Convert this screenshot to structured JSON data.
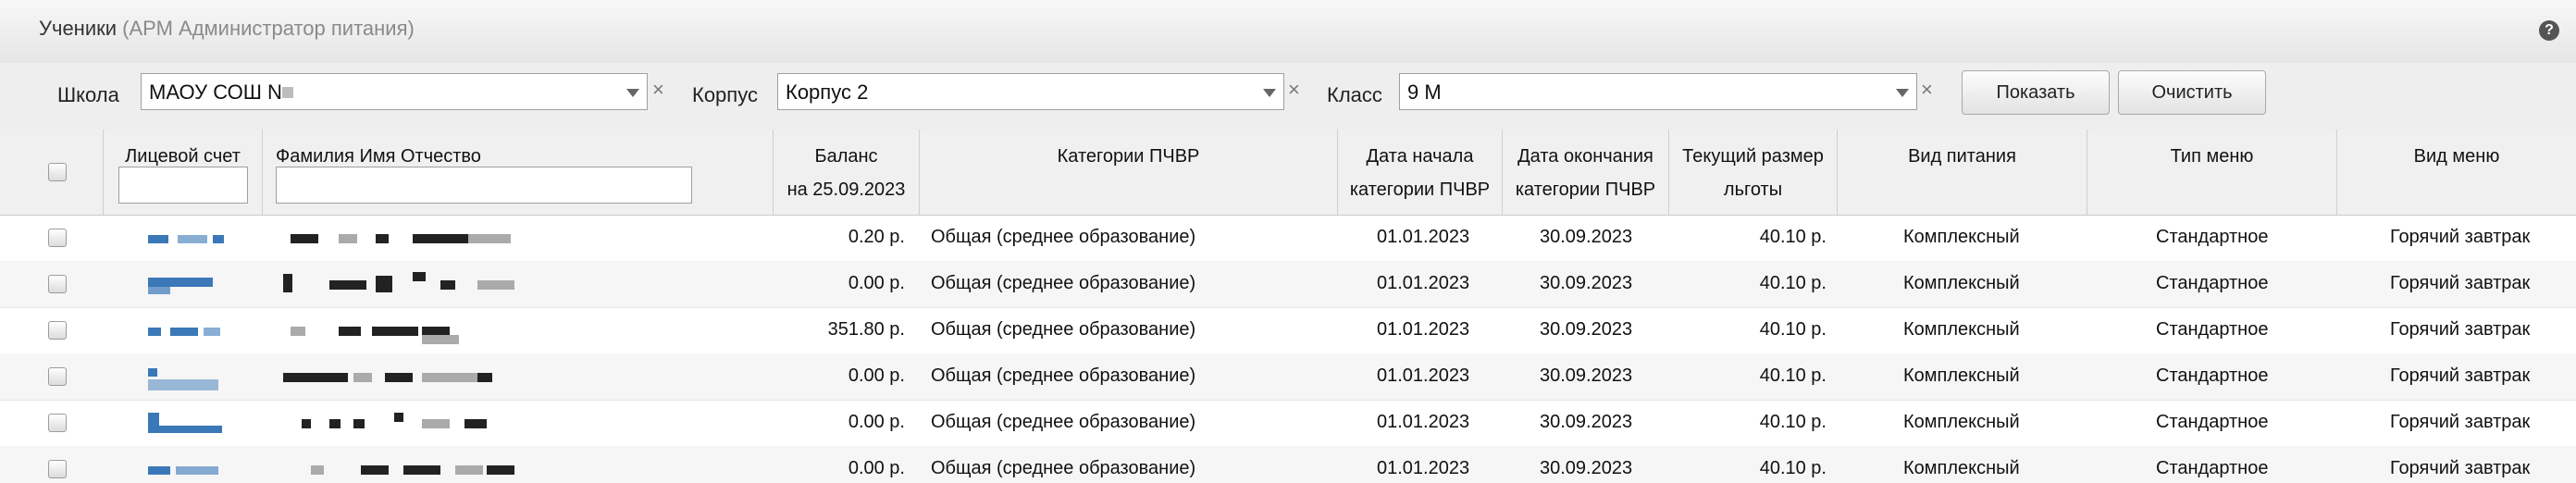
{
  "window": {
    "title": "Ученики",
    "subtitle": "(АРМ Администратор питания)"
  },
  "icons": {
    "help": "help-icon",
    "clear": "close-icon",
    "dropdown": "chevron-down-icon"
  },
  "filters": {
    "school_label": "Школа",
    "school_value": "МАОУ СОШ N",
    "building_label": "Корпус",
    "building_value": "Корпус 2",
    "class_label": "Класс",
    "class_value": "9 М",
    "clear_glyph": "×",
    "show_button": "Показать",
    "reset_button": "Очистить"
  },
  "columns": {
    "account": "Лицевой счет",
    "name": "Фамилия Имя Отчество",
    "balance_line1": "Баланс",
    "balance_line2": "на 25.09.2023",
    "category": "Категории ПЧВР",
    "start_line1": "Дата начала",
    "start_line2": "категории ПЧВР",
    "end_line1": "Дата окончания",
    "end_line2": "категории ПЧВР",
    "benefit_line1": "Текущий размер",
    "benefit_line2": "льготы",
    "meal_type": "Вид питания",
    "menu_type": "Тип меню",
    "menu_kind": "Вид меню"
  },
  "rows": [
    {
      "balance": "0.20 р.",
      "category": "Общая (среднее образование)",
      "start": "01.01.2023",
      "end": "30.09.2023",
      "benefit": "40.10 р.",
      "meal": "Комплексный",
      "menu_type": "Стандартное",
      "menu_kind": "Горячий завтрак"
    },
    {
      "balance": "0.00 р.",
      "category": "Общая (среднее образование)",
      "start": "01.01.2023",
      "end": "30.09.2023",
      "benefit": "40.10 р.",
      "meal": "Комплексный",
      "menu_type": "Стандартное",
      "menu_kind": "Горячий завтрак"
    },
    {
      "balance": "351.80 р.",
      "category": "Общая (среднее образование)",
      "start": "01.01.2023",
      "end": "30.09.2023",
      "benefit": "40.10 р.",
      "meal": "Комплексный",
      "menu_type": "Стандартное",
      "menu_kind": "Горячий завтрак"
    },
    {
      "balance": "0.00 р.",
      "category": "Общая (среднее образование)",
      "start": "01.01.2023",
      "end": "30.09.2023",
      "benefit": "40.10 р.",
      "meal": "Комплексный",
      "menu_type": "Стандартное",
      "menu_kind": "Горячий завтрак"
    },
    {
      "balance": "0.00 р.",
      "category": "Общая (среднее образование)",
      "start": "01.01.2023",
      "end": "30.09.2023",
      "benefit": "40.10 р.",
      "meal": "Комплексный",
      "menu_type": "Стандартное",
      "menu_kind": "Горячий завтрак"
    },
    {
      "balance": "0.00 р.",
      "category": "Общая (среднее образование)",
      "start": "01.01.2023",
      "end": "30.09.2023",
      "benefit": "40.10 р.",
      "meal": "Комплексный",
      "menu_type": "Стандартное",
      "menu_kind": "Горячий завтрак"
    }
  ]
}
